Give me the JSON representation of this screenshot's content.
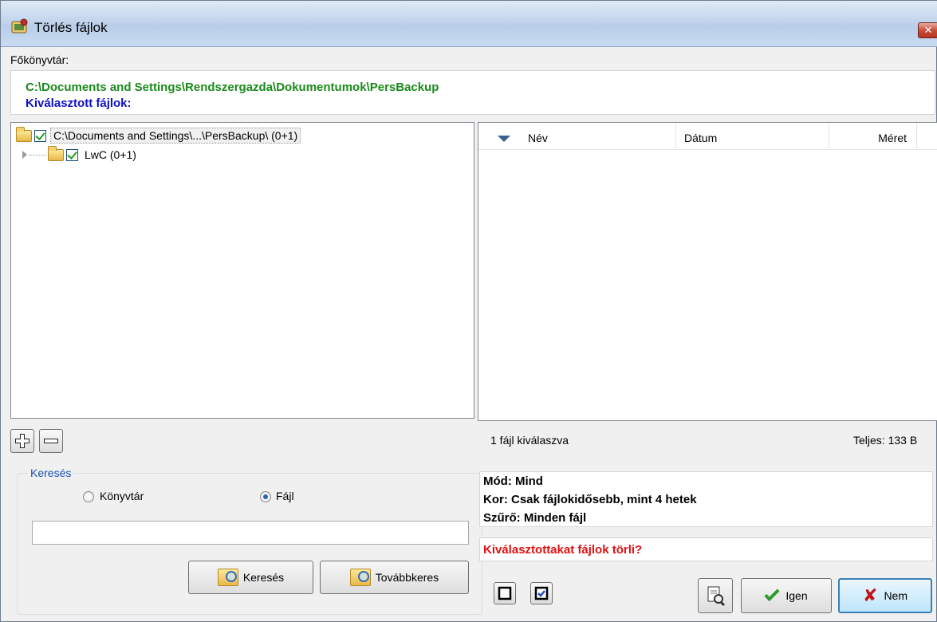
{
  "window": {
    "title": "Törlés fájlok",
    "close_glyph": "✕"
  },
  "root_label": "Főkönyvtár:",
  "root_path": "C:\\Documents and Settings\\Rendszergazda\\Dokumentumok\\PersBackup",
  "selected_files_label": "Kiválasztott fájlok:",
  "tree": {
    "items": [
      {
        "label": "C:\\Documents and Settings\\...\\PersBackup\\ (0+1)",
        "checked": true,
        "icon": "folder-icon"
      },
      {
        "label": "LwC (0+1)",
        "checked": true,
        "icon": "folder-icon"
      }
    ]
  },
  "file_list": {
    "columns": [
      "Név",
      "Dátum",
      "Méret"
    ],
    "rows": []
  },
  "status": {
    "selected": "1 fájl kiválaszva",
    "total": "Teljes: 133 B"
  },
  "search": {
    "legend": "Keresés",
    "radio_directory": "Könyvtár",
    "radio_file": "Fájl",
    "selected_radio": "Fájl",
    "input_value": "",
    "search_button": "Keresés",
    "search_next_button": "Továbbkeres"
  },
  "info": {
    "mode": "Mód: Mind",
    "age": "Kor: Csak fájlokidősebb, mint  4 hetek",
    "filter": "Szűrő: Minden fájl"
  },
  "question": "Kiválasztottakat fájlok törli?",
  "buttons": {
    "yes": "Igen",
    "no": "Nem"
  },
  "colors": {
    "path": "#1a8a1a",
    "label_blue": "#1010c8",
    "question_red": "#e01010",
    "legend_blue": "#1a50b0"
  }
}
